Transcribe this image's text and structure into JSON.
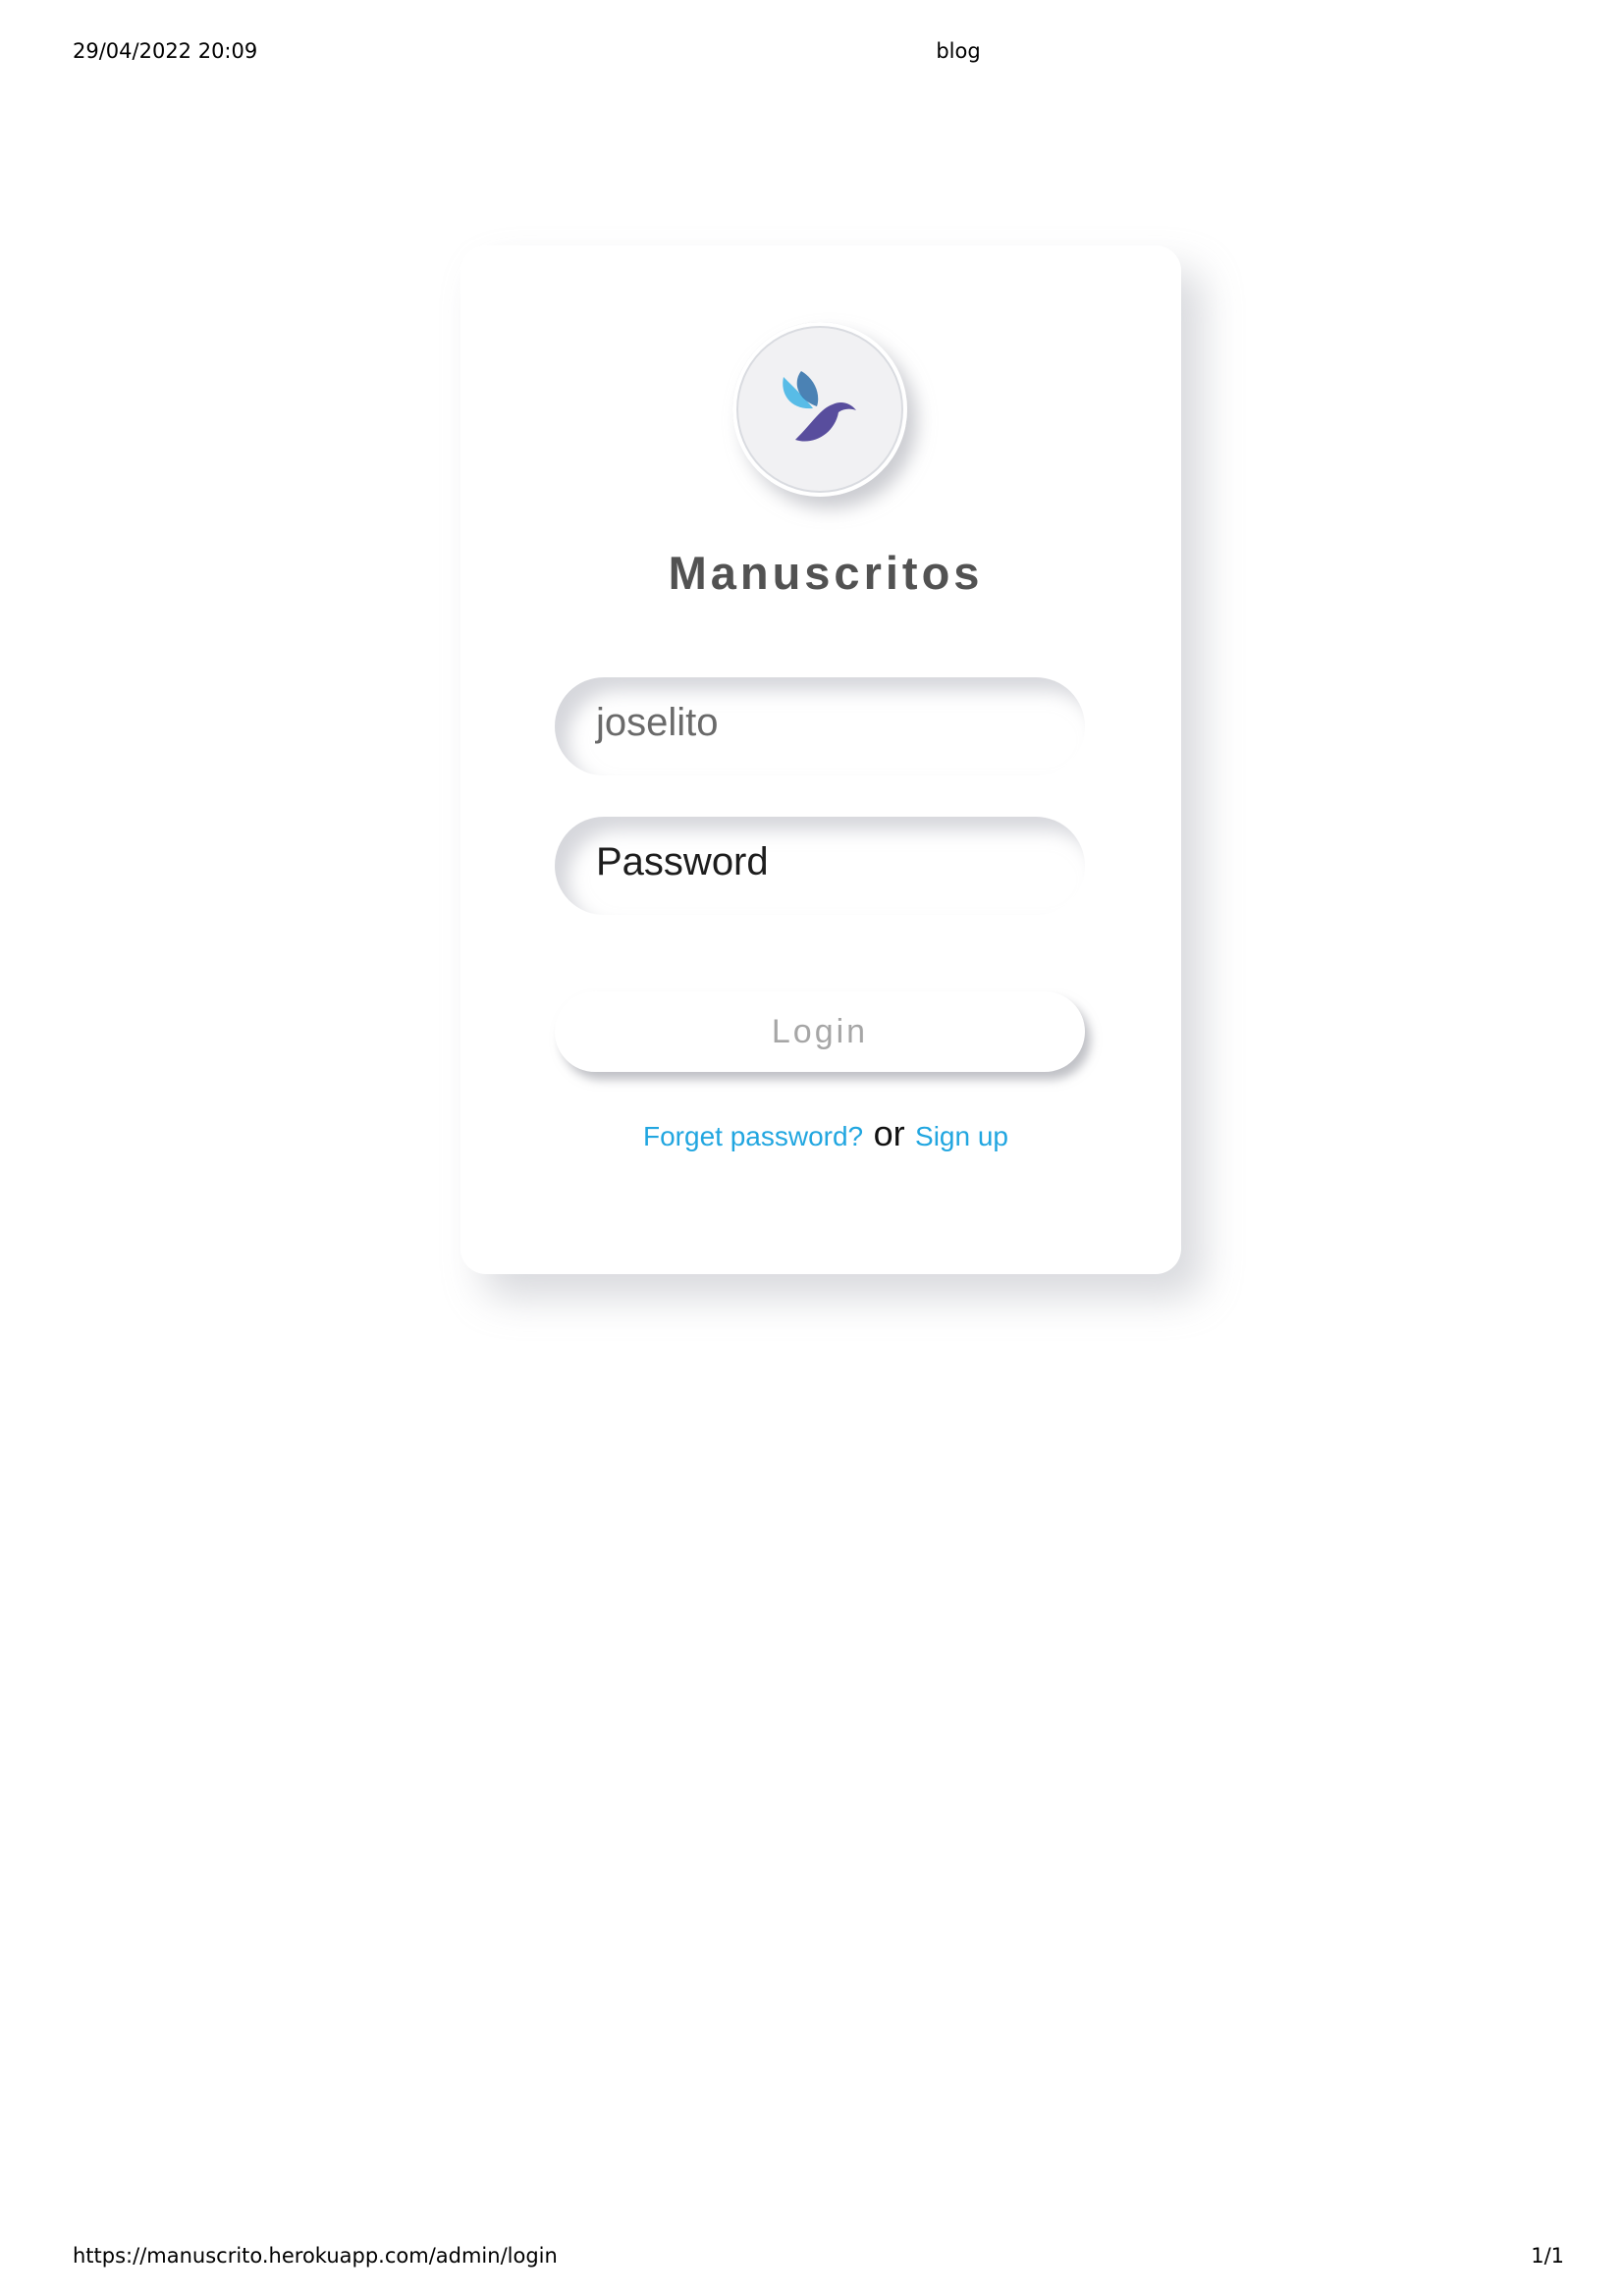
{
  "print_header": {
    "datetime": "29/04/2022 20:09",
    "page_title": "blog"
  },
  "print_footer": {
    "url": "https://manuscrito.herokuapp.com/admin/login",
    "page_number": "1/1"
  },
  "login_card": {
    "logo_icon": "bird-logo-icon",
    "brand_name": "Manuscritos",
    "username_value": "joselito",
    "password_placeholder": "Password",
    "login_label": "Login",
    "forgot_password_label": "Forget password?",
    "or_label": "or",
    "signup_label": "Sign up"
  },
  "colors": {
    "link": "#21a6e0",
    "title": "#525252",
    "logo_light_blue": "#4fb8e6",
    "logo_dark_blue": "#2e6fa8",
    "logo_purple": "#4b3f96"
  }
}
